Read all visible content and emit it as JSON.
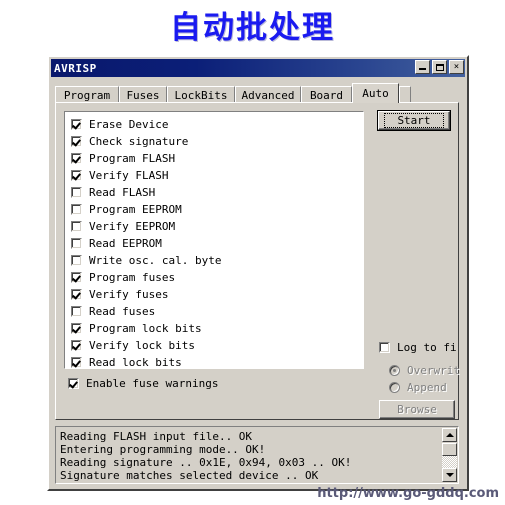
{
  "page": {
    "title": "自动批处理",
    "title_color": "#1a1af0",
    "watermark": "http://www.go-gddq.com"
  },
  "window": {
    "title": "AVRISP",
    "titlebar_color": "#0a186c",
    "face_color": "#d4d0c8",
    "buttons": {
      "minimize": "minimize-icon",
      "maximize": "maximize-icon",
      "close": "×"
    }
  },
  "tabs": [
    {
      "label": "Program",
      "active": false
    },
    {
      "label": "Fuses",
      "active": false
    },
    {
      "label": "LockBits",
      "active": false
    },
    {
      "label": "Advanced",
      "active": false
    },
    {
      "label": "Board",
      "active": false
    },
    {
      "label": "Auto",
      "active": true
    }
  ],
  "checklist": [
    {
      "label": "Erase Device",
      "checked": true
    },
    {
      "label": "Check signature",
      "checked": true
    },
    {
      "label": "Program FLASH",
      "checked": true
    },
    {
      "label": "Verify FLASH",
      "checked": true
    },
    {
      "label": "Read FLASH",
      "checked": false
    },
    {
      "label": "Program EEPROM",
      "checked": false
    },
    {
      "label": "Verify EEPROM",
      "checked": false
    },
    {
      "label": "Read EEPROM",
      "checked": false
    },
    {
      "label": "Write osc. cal. byte",
      "checked": false
    },
    {
      "label": "Program fuses",
      "checked": true
    },
    {
      "label": "Verify fuses",
      "checked": true
    },
    {
      "label": "Read fuses",
      "checked": false
    },
    {
      "label": "Program lock bits",
      "checked": true
    },
    {
      "label": "Verify lock bits",
      "checked": true
    },
    {
      "label": "Read lock bits",
      "checked": true
    }
  ],
  "controls": {
    "start_label": "Start",
    "log_to_file_label": "Log to fi",
    "log_to_file_checked": false,
    "overwrite_label": "Overwrit",
    "overwrite_selected": true,
    "append_label": "Append",
    "append_selected": false,
    "browse_label": "Browse",
    "browse_enabled": false,
    "fuse_warnings_label": "Enable fuse warnings",
    "fuse_warnings_checked": true
  },
  "log": {
    "lines": "Reading FLASH input file.. OK\nEntering programming mode.. OK!\nReading signature .. 0x1E, 0x94, 0x03 .. OK!\nSignature matches selected device .. OK"
  }
}
